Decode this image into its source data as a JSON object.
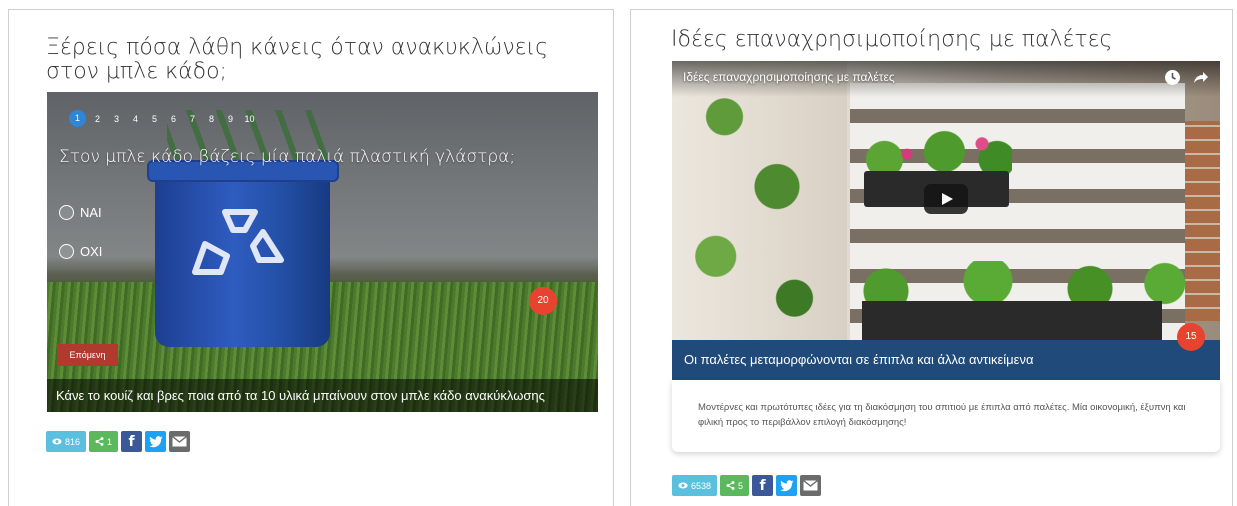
{
  "left_article": {
    "title": "Ξέρεις πόσα λάθη κάνεις όταν ανακυκλώνεις στον μπλε κάδο;",
    "quiz": {
      "pages": [
        "1",
        "2",
        "3",
        "4",
        "5",
        "6",
        "7",
        "8",
        "9",
        "10"
      ],
      "active_page": "1",
      "question": "Στον μπλε κάδο βάζεις μία παλιά πλαστική γλάστρα;",
      "options": [
        "ΝΑΙ",
        "ΟΧΙ"
      ],
      "next_label": "Επόμενη",
      "caption": "Κάνε το κουίζ και βρες ποια από τα 10 υλικά μπαίνουν στον μπλε κάδο ανακύκλωσης",
      "badge_count": "20"
    },
    "views": "816",
    "shares": "1"
  },
  "right_article": {
    "title": "Ιδέες επαναχρησιμοποίησης με παλέτες",
    "video": {
      "title": "Ιδέες επαναχρησιμοποίησης με παλέτες",
      "icons": [
        "clock-icon",
        "share-arrow-icon",
        "play-icon"
      ]
    },
    "caption": "Οι παλέτες μεταμορφώνονται σε έπιπλα και άλλα αντικείμενα",
    "badge_count": "15",
    "description": "Μοντέρνες και πρωτότυπες ιδέες για τη διακόσμηση του σπιτιού με έπιπλα από παλέτες. Μία οικονομική, έξυπνη και φιλική προς το περιβάλλον επιλογή διακόσμησης!",
    "views": "6538",
    "shares": "5"
  },
  "social": {
    "facebook_glyph": "f",
    "icons": [
      "eye-icon",
      "share-icon",
      "facebook-icon",
      "twitter-icon",
      "mail-icon"
    ]
  },
  "colors": {
    "views_pill": "#5bc0de",
    "shares_pill": "#5cb85c",
    "facebook": "#3b5998",
    "twitter": "#1da1f2",
    "badge": "#e8432e",
    "next_button": "#b03a2e",
    "video_caption_bg": "#1f4a7a",
    "active_page": "#2f86d6"
  }
}
